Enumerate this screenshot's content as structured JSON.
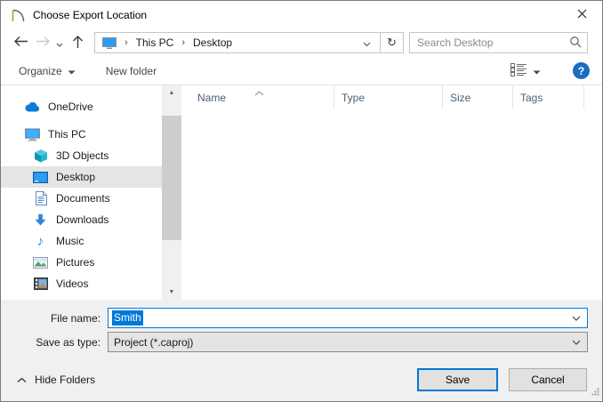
{
  "window": {
    "title": "Choose Export Location"
  },
  "breadcrumb": {
    "items": [
      "This PC",
      "Desktop"
    ],
    "separator": "›"
  },
  "search": {
    "placeholder": "Search Desktop"
  },
  "toolbar": {
    "organize_label": "Organize",
    "new_folder_label": "New folder"
  },
  "list": {
    "columns": [
      "Name",
      "Type",
      "Size",
      "Tags"
    ]
  },
  "sidebar": {
    "items": [
      {
        "label": "OneDrive"
      },
      {
        "label": "This PC"
      },
      {
        "label": "3D Objects"
      },
      {
        "label": "Desktop",
        "selected": true
      },
      {
        "label": "Documents"
      },
      {
        "label": "Downloads"
      },
      {
        "label": "Music"
      },
      {
        "label": "Pictures"
      },
      {
        "label": "Videos"
      }
    ]
  },
  "form": {
    "file_name_label": "File name:",
    "file_name_value": "Smith",
    "save_as_type_label": "Save as type:",
    "save_as_type_value": "Project (*.caproj)"
  },
  "footer": {
    "hide_folders_label": "Hide Folders",
    "save_label": "Save",
    "cancel_label": "Cancel"
  },
  "icons": {
    "help_glyph": "?",
    "music_glyph": "♪",
    "scroll_up_glyph": "▲",
    "scroll_down_glyph": "▼",
    "refresh_glyph": "↻"
  },
  "colors": {
    "accent": "#0078d7",
    "selection": "#0078d7",
    "help_blue": "#1b6dc1",
    "footer_bg": "#f0f0f0"
  }
}
